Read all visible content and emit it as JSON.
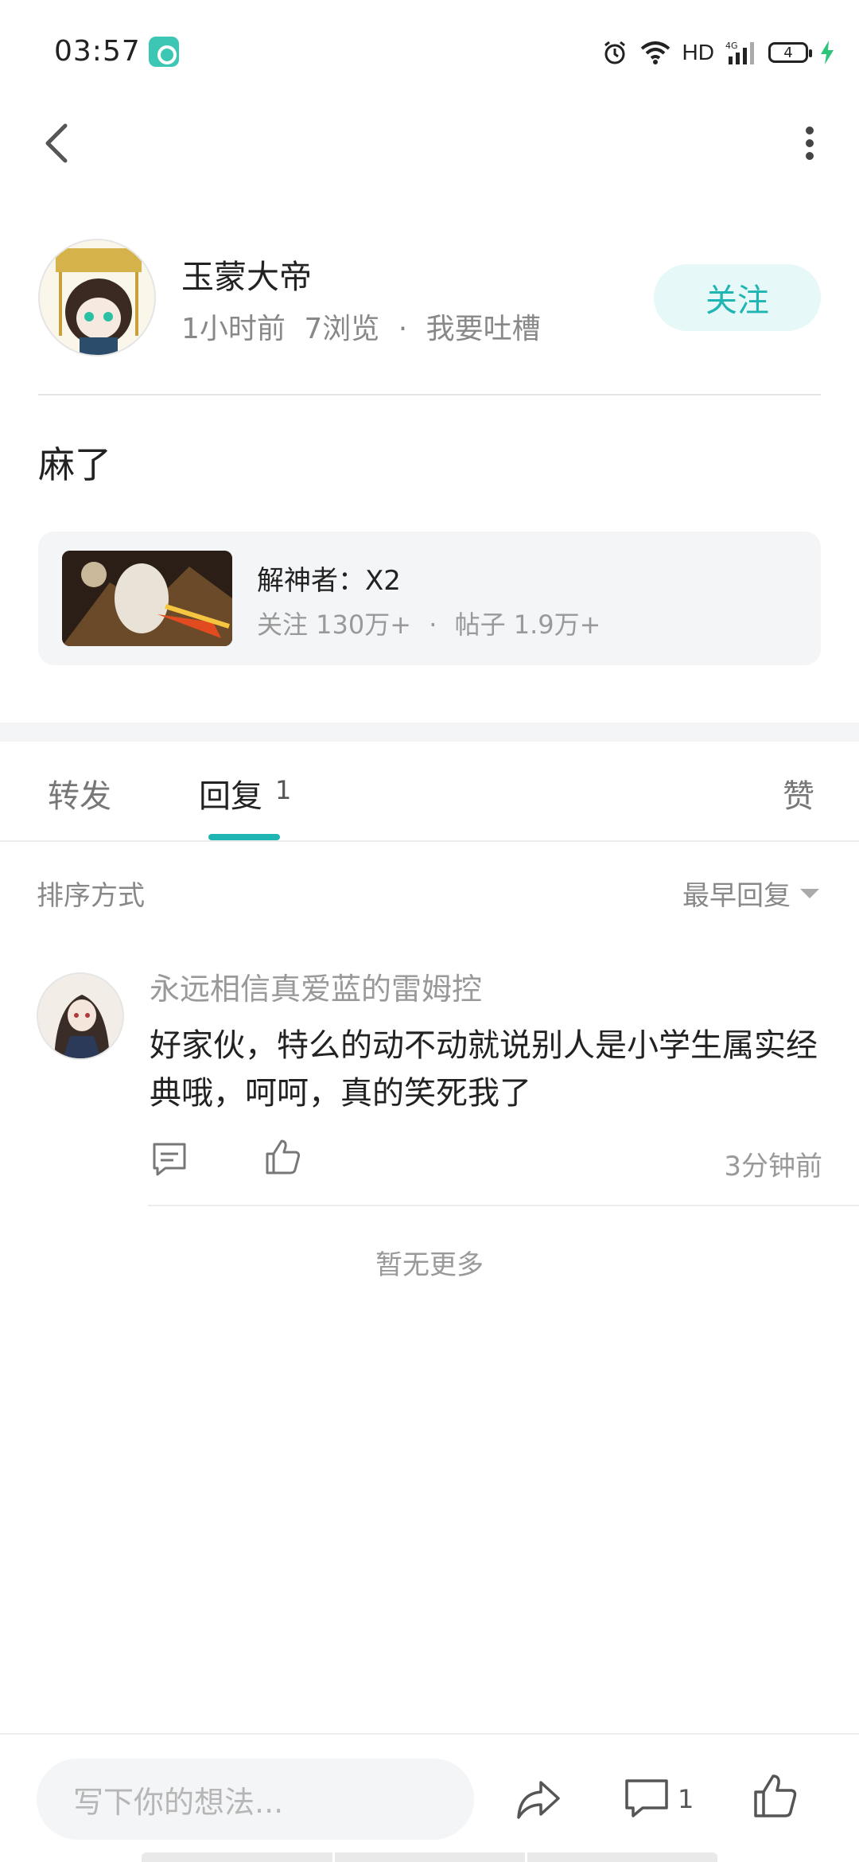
{
  "status_bar": {
    "time": "03:57",
    "network_label": "HD",
    "signal_label": "4G",
    "battery_level": "4"
  },
  "post": {
    "author_name": "玉蒙大帝",
    "time_ago": "1小时前",
    "views": "7浏览",
    "category": "我要吐槽",
    "follow_label": "关注",
    "content": "麻了"
  },
  "game_card": {
    "name": "解神者：X2",
    "followers": "关注 130万+",
    "posts": "帖子 1.9万+"
  },
  "tabs": {
    "repost": "转发",
    "reply": "回复",
    "reply_count": "1",
    "like": "赞"
  },
  "sort": {
    "label": "排序方式",
    "value": "最早回复"
  },
  "comments": [
    {
      "user": "永远相信真爱蓝的雷姆控",
      "text": "好家伙，特么的动不动就说别人是小学生属实经典哦，呵呵，真的笑死我了",
      "time": "3分钟前"
    }
  ],
  "no_more": "暂无更多",
  "bottom_bar": {
    "input_placeholder": "写下你的想法...",
    "comment_count": "1"
  },
  "colors": {
    "accent": "#1fb5b2",
    "follow_bg": "#e6f8f7",
    "card_bg": "#f4f5f7"
  }
}
